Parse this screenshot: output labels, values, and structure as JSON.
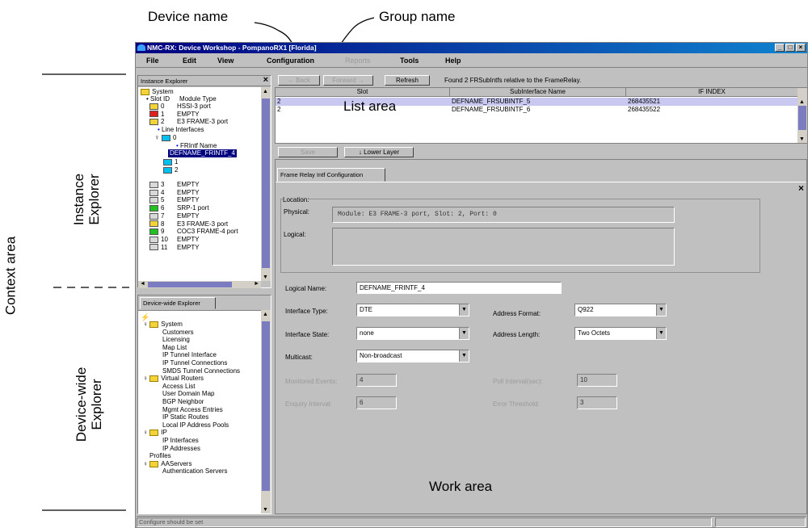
{
  "annotations": {
    "device_name": "Device name",
    "group_name": "Group name",
    "instance_explorer": [
      "Instance",
      "Explorer"
    ],
    "context_area": "Context area",
    "device_wide_explorer": [
      "Device-wide",
      "Explorer"
    ],
    "list_area": "List area",
    "work_area": "Work area"
  },
  "window": {
    "title": "NMC-RX: Device Workshop - PompanoRX1 [Florida]",
    "controls": [
      "_",
      "□",
      "×"
    ]
  },
  "menu": [
    "File",
    "Edit",
    "View",
    "Configuration",
    "Reports",
    "Tools",
    "Help"
  ],
  "instance_explorer": {
    "title": "Instance Explorer",
    "close": "×",
    "root": "System",
    "slot_header": {
      "label": "Slot ID",
      "type": "Module Type"
    },
    "slots": [
      {
        "id": "0",
        "type": "HSSI-3 port",
        "color": "#f2d43a"
      },
      {
        "id": "1",
        "type": "EMPTY",
        "color": "#e02020"
      },
      {
        "id": "2",
        "type": "E3 FRAME-3 port",
        "color": "#f2d43a"
      }
    ],
    "line_interfaces": "Line Interfaces",
    "sub0": "0",
    "frintf_name": "FRIntf Name",
    "selected": "DEFNAME_FRINTF_4",
    "sub1": "1",
    "sub2": "2",
    "more_slots": [
      {
        "id": "3",
        "type": "EMPTY",
        "color": "#d8d8d8"
      },
      {
        "id": "4",
        "type": "EMPTY",
        "color": "#d8d8d8"
      },
      {
        "id": "5",
        "type": "EMPTY",
        "color": "#d8d8d8"
      },
      {
        "id": "6",
        "type": "SRP-1 port",
        "color": "#22c022"
      },
      {
        "id": "7",
        "type": "EMPTY",
        "color": "#d8d8d8"
      },
      {
        "id": "8",
        "type": "E3 FRAME-3 port",
        "color": "#f2d43a"
      },
      {
        "id": "9",
        "type": "COC3 FRAME-4 port",
        "color": "#22c022"
      },
      {
        "id": "10",
        "type": "EMPTY",
        "color": "#d8d8d8"
      },
      {
        "id": "11",
        "type": "EMPTY",
        "color": "#d8d8d8"
      }
    ]
  },
  "device_explorer": {
    "tab": "Device-wide Explorer",
    "items": [
      {
        "label": "System",
        "folder": true,
        "indent": 0
      },
      {
        "label": "Customers",
        "indent": 1
      },
      {
        "label": "Licensing",
        "indent": 1
      },
      {
        "label": "Map List",
        "indent": 1
      },
      {
        "label": "IP Tunnel Interface",
        "indent": 1
      },
      {
        "label": "IP Tunnel Connections",
        "indent": 1
      },
      {
        "label": "SMDS Tunnel Connections",
        "indent": 1
      },
      {
        "label": "Virtual Routers",
        "folder": true,
        "indent": 0
      },
      {
        "label": "Access List",
        "indent": 1
      },
      {
        "label": "User Domain Map",
        "indent": 1
      },
      {
        "label": "BGP Neighbor",
        "indent": 1
      },
      {
        "label": "Mgmt Access Entries",
        "indent": 1
      },
      {
        "label": "IP Static Routes",
        "indent": 1
      },
      {
        "label": "Local IP Address Pools",
        "indent": 1
      },
      {
        "label": "IP",
        "folder": true,
        "indent": 0
      },
      {
        "label": "IP Interfaces",
        "indent": 1
      },
      {
        "label": "IP Addresses",
        "indent": 1
      },
      {
        "label": "Profiles",
        "indent": 0,
        "plain": true
      },
      {
        "label": "AAServers",
        "folder": true,
        "indent": 0
      },
      {
        "label": "Authentication Servers",
        "indent": 1
      }
    ]
  },
  "toolbar": {
    "back": "← Back",
    "forward": "Forward →",
    "refresh": "Refresh",
    "found": "Found 2 FRSubIntfs relative to the FrameRelay."
  },
  "list": {
    "columns": [
      "Slot",
      "SubInterface Name",
      "IF INDEX"
    ],
    "rows": [
      [
        "2",
        "DEFNAME_FRSUBINTF_5",
        "268435521"
      ],
      [
        "2",
        "DEFNAME_FRSUBINTF_6",
        "268435522"
      ]
    ]
  },
  "work": {
    "save": "Save",
    "lower_layer": "↓ Lower Layer",
    "tab": "Frame Relay Intf Configuration",
    "close": "×",
    "location_label": "Location:",
    "physical_label": "Physical:",
    "physical_value": "Module: E3 FRAME-3 port, Slot: 2, Port: 0",
    "logical_label": "Logical:",
    "logical_name_label": "Logical Name:",
    "logical_name_value": "DEFNAME_FRINTF_4",
    "interface_type_label": "Interface Type:",
    "interface_type_value": "DTE",
    "address_format_label": "Address Format:",
    "address_format_value": "Q922",
    "interface_state_label": "Interface State:",
    "interface_state_value": "none",
    "address_length_label": "Address Length:",
    "address_length_value": "Two Octets",
    "multicast_label": "Multicast:",
    "multicast_value": "Non-broadcast",
    "monitored_events_label": "Monitored Events:",
    "monitored_events_value": "4",
    "poll_interval_label": "Poll Interval(sec):",
    "poll_interval_value": "10",
    "enquiry_interval_label": "Enquiry Interval:",
    "enquiry_interval_value": "6",
    "error_threshold_label": "Error Threshold:",
    "error_threshold_value": "3"
  },
  "status": "Configure should be set"
}
